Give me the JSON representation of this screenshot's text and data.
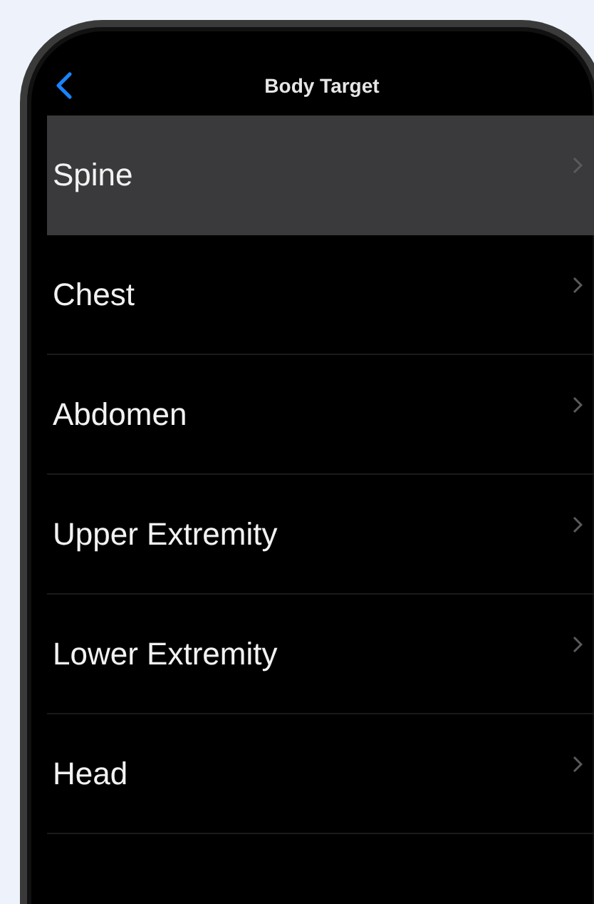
{
  "nav_bar": {
    "title": "Body Target"
  },
  "items": [
    {
      "label": "Spine",
      "selected": true
    },
    {
      "label": "Chest",
      "selected": false
    },
    {
      "label": "Abdomen",
      "selected": false
    },
    {
      "label": "Upper Extremity",
      "selected": false
    },
    {
      "label": "Lower Extremity",
      "selected": false
    },
    {
      "label": "Head",
      "selected": false
    }
  ]
}
